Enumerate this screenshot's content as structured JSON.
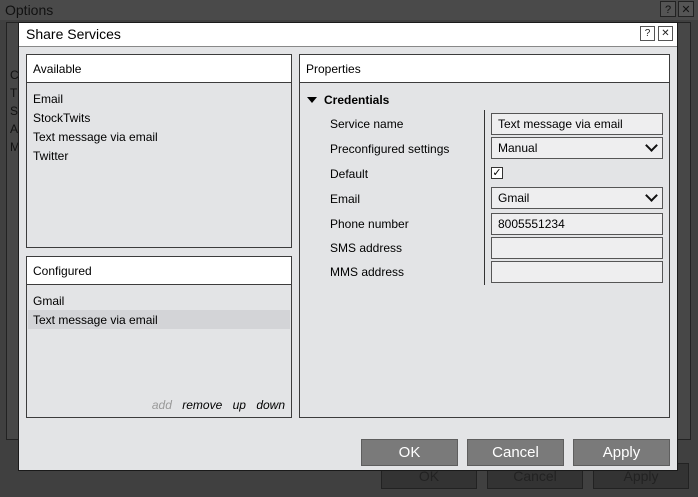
{
  "background_window": {
    "title": "Options",
    "help_label": "?",
    "close_label": "✕",
    "side_letters": [
      "C",
      "T",
      "S",
      "A",
      "M"
    ],
    "buttons": {
      "ok": "OK",
      "cancel": "Cancel",
      "apply": "Apply"
    }
  },
  "dialog": {
    "title": "Share Services",
    "help_label": "?",
    "close_label": "✕",
    "available": {
      "header": "Available",
      "items": [
        "Email",
        "StockTwits",
        "Text message via email",
        "Twitter"
      ]
    },
    "configured": {
      "header": "Configured",
      "items": [
        "Gmail",
        "Text message via email"
      ],
      "selected_item": "Text message via email",
      "actions": {
        "add": "add",
        "remove": "remove",
        "up": "up",
        "down": "down"
      }
    },
    "properties": {
      "header": "Properties",
      "section": "Credentials",
      "service_name": {
        "label": "Service name",
        "value": "Text message via email"
      },
      "preconfigured": {
        "label": "Preconfigured settings",
        "value": "Manual"
      },
      "default": {
        "label": "Default",
        "checked": true,
        "mark": "✓"
      },
      "email": {
        "label": "Email",
        "value": "Gmail"
      },
      "phone": {
        "label": "Phone number",
        "value": "8005551234"
      },
      "sms": {
        "label": "SMS address",
        "value": ""
      },
      "mms": {
        "label": "MMS address",
        "value": ""
      }
    },
    "buttons": {
      "ok": "OK",
      "cancel": "Cancel",
      "apply": "Apply"
    }
  }
}
